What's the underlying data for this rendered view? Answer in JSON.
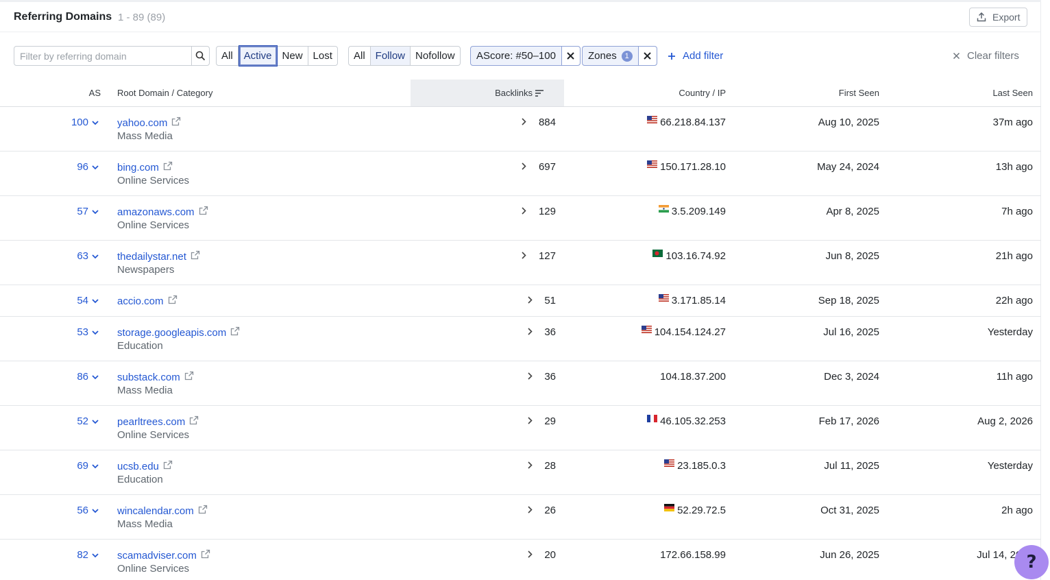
{
  "header": {
    "title": "Referring Domains",
    "count": "1 - 89 (89)",
    "export_label": "Export"
  },
  "filters": {
    "search_placeholder": "Filter by referring domain",
    "status_options": [
      "All",
      "Active",
      "New",
      "Lost"
    ],
    "status_selected": "Active",
    "link_type_options": [
      "All",
      "Follow",
      "Nofollow"
    ],
    "link_type_selected": "Follow",
    "ascore_chip": "AScore: #50–100",
    "zones_chip": "Zones",
    "zones_count": "1",
    "add_filter_label": "Add filter",
    "clear_filters_label": "Clear filters"
  },
  "table": {
    "columns": {
      "as": "AS",
      "root_domain": "Root Domain / Category",
      "backlinks": "Backlinks",
      "country_ip": "Country / IP",
      "first_seen": "First Seen",
      "last_seen": "Last Seen"
    },
    "rows": [
      {
        "as": "100",
        "domain": "yahoo.com",
        "category": "Mass Media",
        "backlinks": "884",
        "flag": "us",
        "ip": "66.218.84.137",
        "first_seen": "Aug 10, 2025",
        "last_seen": "37m ago"
      },
      {
        "as": "96",
        "domain": "bing.com",
        "category": "Online Services",
        "backlinks": "697",
        "flag": "us",
        "ip": "150.171.28.10",
        "first_seen": "May 24, 2024",
        "last_seen": "13h ago"
      },
      {
        "as": "57",
        "domain": "amazonaws.com",
        "category": "Online Services",
        "backlinks": "129",
        "flag": "in",
        "ip": "3.5.209.149",
        "first_seen": "Apr 8, 2025",
        "last_seen": "7h ago"
      },
      {
        "as": "63",
        "domain": "thedailystar.net",
        "category": "Newspapers",
        "backlinks": "127",
        "flag": "bd",
        "ip": "103.16.74.92",
        "first_seen": "Jun 8, 2025",
        "last_seen": "21h ago"
      },
      {
        "as": "54",
        "domain": "accio.com",
        "category": "",
        "backlinks": "51",
        "flag": "us",
        "ip": "3.171.85.14",
        "first_seen": "Sep 18, 2025",
        "last_seen": "22h ago"
      },
      {
        "as": "53",
        "domain": "storage.googleapis.com",
        "category": "Education",
        "backlinks": "36",
        "flag": "us",
        "ip": "104.154.124.27",
        "first_seen": "Jul 16, 2025",
        "last_seen": "Yesterday"
      },
      {
        "as": "86",
        "domain": "substack.com",
        "category": "Mass Media",
        "backlinks": "36",
        "flag": "",
        "ip": "104.18.37.200",
        "first_seen": "Dec 3, 2024",
        "last_seen": "11h ago"
      },
      {
        "as": "52",
        "domain": "pearltrees.com",
        "category": "Online Services",
        "backlinks": "29",
        "flag": "fr",
        "ip": "46.105.32.253",
        "first_seen": "Feb 17, 2026",
        "last_seen": "Aug 2, 2026"
      },
      {
        "as": "69",
        "domain": "ucsb.edu",
        "category": "Education",
        "backlinks": "28",
        "flag": "us",
        "ip": "23.185.0.3",
        "first_seen": "Jul 11, 2025",
        "last_seen": "Yesterday"
      },
      {
        "as": "56",
        "domain": "wincalendar.com",
        "category": "Mass Media",
        "backlinks": "26",
        "flag": "de",
        "ip": "52.29.72.5",
        "first_seen": "Oct 31, 2025",
        "last_seen": "2h ago"
      },
      {
        "as": "82",
        "domain": "scamadviser.com",
        "category": "Online Services",
        "backlinks": "20",
        "flag": "",
        "ip": "172.66.158.99",
        "first_seen": "Jun 26, 2025",
        "last_seen": "Jul 14, 2026"
      }
    ]
  },
  "help": {
    "label": "?"
  },
  "colors": {
    "link": "#2458d3",
    "selected_bg": "#eef2fb",
    "help_bg": "#a98af0"
  }
}
